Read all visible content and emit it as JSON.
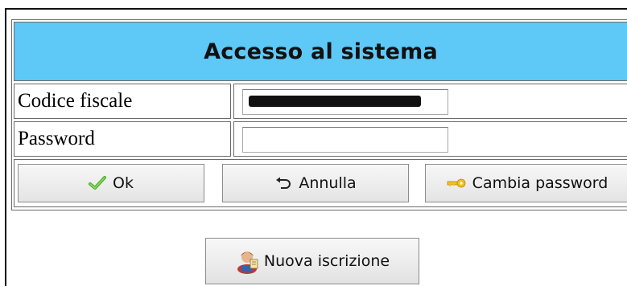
{
  "login": {
    "title": "Accesso al sistema",
    "fields": {
      "codice_fiscale_label": "Codice fiscale",
      "codice_fiscale_value": "",
      "password_label": "Password",
      "password_value": ""
    },
    "buttons": {
      "ok": "Ok",
      "annulla": "Annulla",
      "cambia_password": "Cambia password",
      "nuova_iscrizione": "Nuova iscrizione"
    }
  },
  "colors": {
    "header_bg": "#5ec8f7",
    "check_icon": "#4caf2a",
    "key_icon": "#f2c21b"
  },
  "icons": {
    "ok": "check-icon",
    "annulla": "undo-icon",
    "cambia_password": "key-icon",
    "nuova_iscrizione": "user-icon"
  }
}
